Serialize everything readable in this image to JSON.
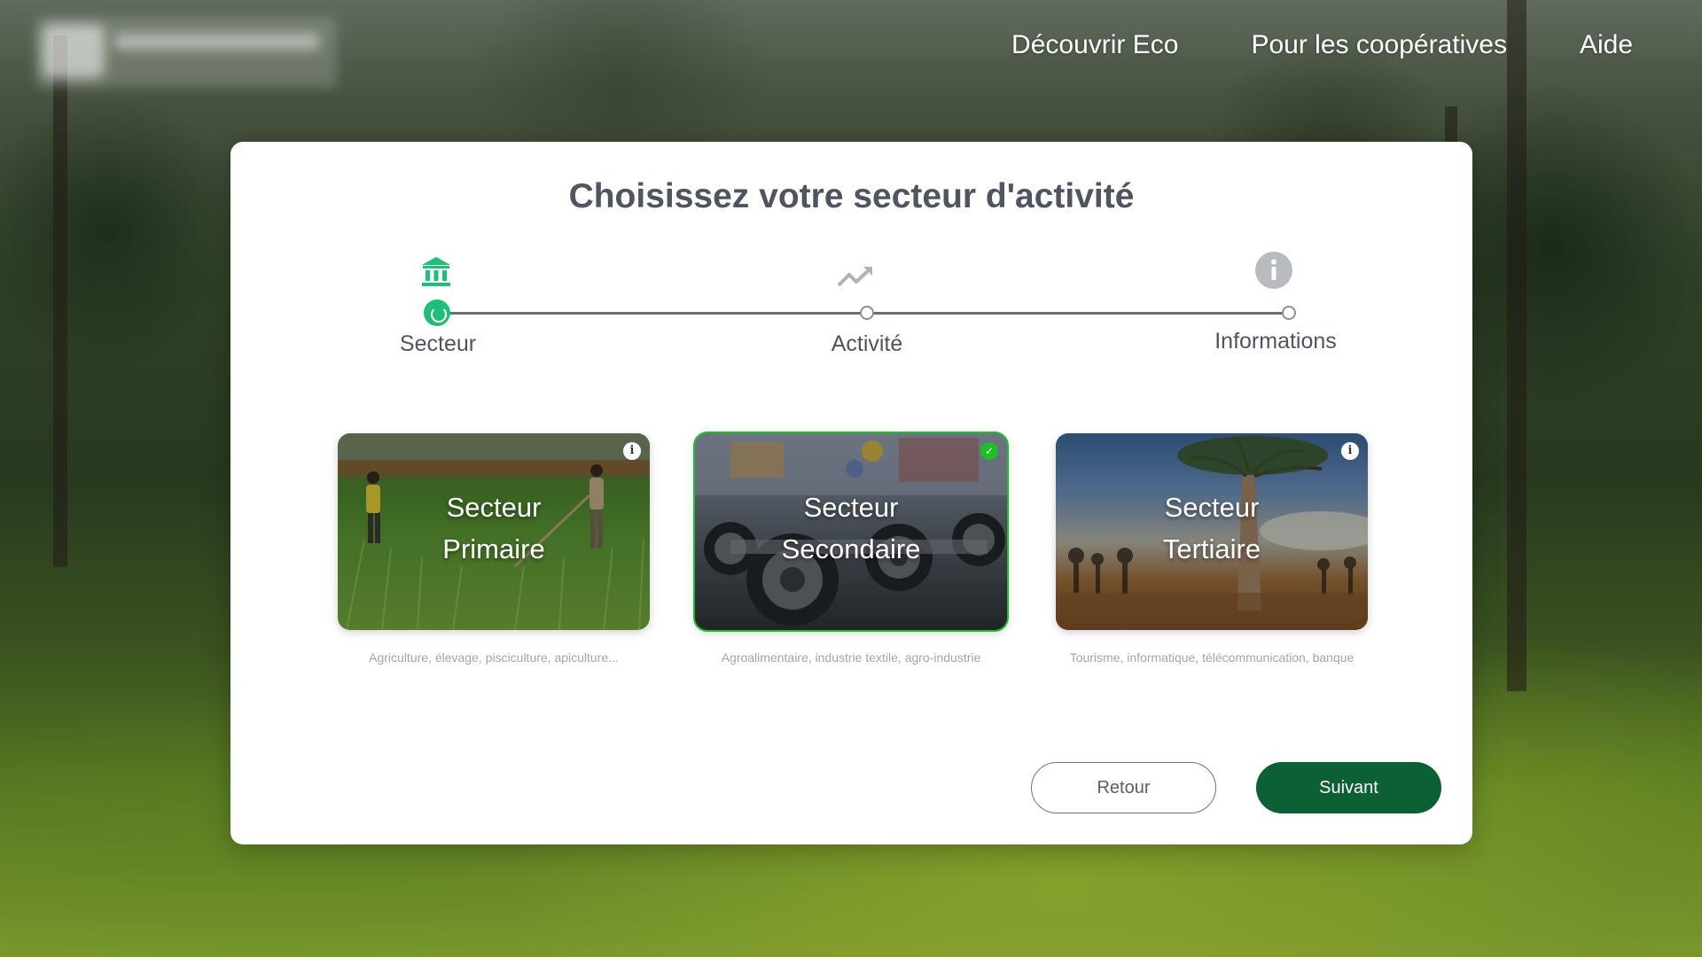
{
  "nav": {
    "items": [
      {
        "label": "Découvrir Eco"
      },
      {
        "label": "Pour les coopératives"
      },
      {
        "label": "Aide"
      }
    ]
  },
  "modal": {
    "title": "Choisissez votre secteur d'activité",
    "steps": [
      {
        "label": "Secteur",
        "icon": "bank-icon",
        "state": "active"
      },
      {
        "label": "Activité",
        "icon": "trending-up-icon",
        "state": "pending"
      },
      {
        "label": "Informations",
        "icon": "info-icon",
        "state": "pending"
      }
    ],
    "cards": [
      {
        "title_line1": "Secteur",
        "title_line2": "Primaire",
        "description": "Agriculture, élevage, pisciculture, apiculture...",
        "badge": "info-icon",
        "selected": false
      },
      {
        "title_line1": "Secteur",
        "title_line2": "Secondaire",
        "description": "Agroalimentaire, industrie textile, agro-industrie",
        "badge": "check-icon",
        "selected": true
      },
      {
        "title_line1": "Secteur",
        "title_line2": "Tertiaire",
        "description": "Tourisme, informatique, télécommunication, banque",
        "badge": "info-icon",
        "selected": false
      }
    ],
    "buttons": {
      "back": "Retour",
      "next": "Suivant"
    }
  },
  "colors": {
    "accent": "#1fbf7a",
    "selected_border": "#1fbf2a",
    "primary_button": "#0d5f36"
  }
}
